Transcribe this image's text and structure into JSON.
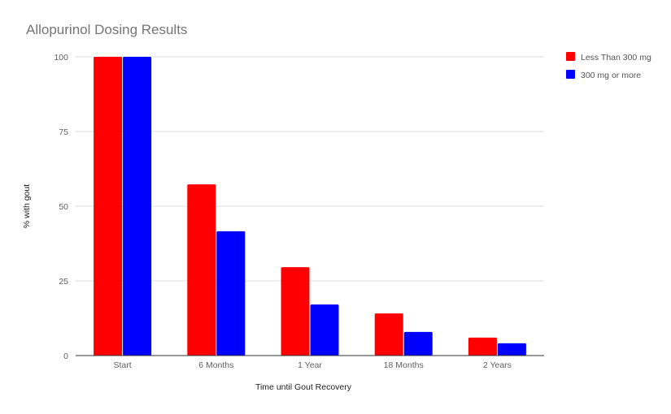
{
  "chart_data": {
    "type": "bar",
    "title": "Allopurinol Dosing Results",
    "xlabel": "Time until Gout Recovery",
    "ylabel": "% with gout",
    "categories": [
      "Start",
      "6 Months",
      "1 Year",
      "18 Months",
      "2 Years"
    ],
    "series": [
      {
        "name": "Less Than 300 mg",
        "color": "#ff0000",
        "values": [
          100,
          57.3,
          29.6,
          14.1,
          6.0
        ]
      },
      {
        "name": "300 mg or more",
        "color": "#0000ff",
        "values": [
          100,
          41.6,
          17.1,
          7.9,
          4.1
        ]
      }
    ],
    "ylim": [
      0,
      100
    ],
    "yticks": [
      0,
      25,
      50,
      75,
      100
    ],
    "grid": true,
    "legend": "right"
  }
}
